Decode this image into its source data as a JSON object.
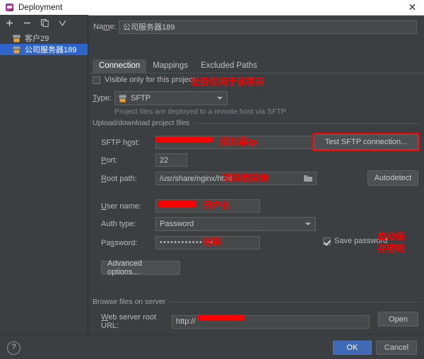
{
  "window": {
    "title": "Deployment",
    "icon": "jetbrains-icon",
    "close_label": "✕"
  },
  "sidebar": {
    "toolbar": [
      {
        "name": "add-button",
        "label": "+"
      },
      {
        "name": "remove-button",
        "label": "−"
      },
      {
        "name": "copy-button",
        "label": "copy-icon"
      },
      {
        "name": "set-default-button",
        "label": "✓"
      }
    ],
    "items": [
      {
        "label": "客户29",
        "selected": false
      },
      {
        "label": "公司服务器189",
        "selected": true
      }
    ]
  },
  "form": {
    "name_label": "Name:",
    "name_value": "公司服务器189",
    "tabs": [
      {
        "label": "Connection",
        "active": true
      },
      {
        "label": "Mappings",
        "active": false
      },
      {
        "label": "Excluded Paths",
        "active": false
      }
    ],
    "visible_only_label": "Visible only for this project",
    "visible_only_checked": false,
    "type_label": "Type:",
    "type_value": "SFTP",
    "type_hint": "Project files are deployed to a remote host via SFTP",
    "upload_section_title": "Upload/download project files",
    "sftp_host_label": "SFTP host:",
    "sftp_host_value": "",
    "test_connection_label": "Test SFTP connection...",
    "port_label": "Port:",
    "port_value": "22",
    "root_path_label": "Root path:",
    "root_path_value": "/usr/share/nginx/html",
    "autodetect_label": "Autodetect",
    "user_name_label": "User name:",
    "user_name_value": "",
    "auth_type_label": "Auth type:",
    "auth_type_value": "Password",
    "password_label": "Password:",
    "password_value": "•••••••••••••••",
    "save_password_label": "Save password",
    "save_password_checked": true,
    "advanced_options_label": "Advanced options...",
    "browse_section_title": "Browse files on server",
    "web_root_label": "Web server root URL:",
    "web_root_value": "http://",
    "open_label": "Open"
  },
  "annotations": {
    "visible_only": "是否仅用于该项目",
    "sftp_host": "服务器ip",
    "root_path": "项目根目录",
    "user_name": "用户名",
    "password": "密码",
    "save_password_1": "自动保",
    "save_password_2": "存密码",
    "color": "#fc0000"
  },
  "footer": {
    "help_label": "?",
    "ok_label": "OK",
    "cancel_label": "Cancel"
  }
}
